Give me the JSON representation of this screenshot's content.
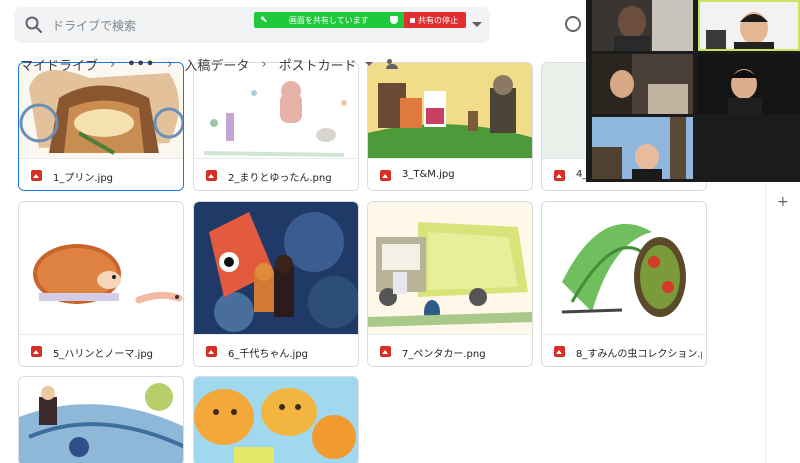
{
  "search": {
    "placeholder": "ドライブで検索"
  },
  "screen_share": {
    "status_label": "画面を共有しています",
    "stop_label": "共有の停止"
  },
  "breadcrumb": {
    "root": "マイドライブ",
    "more": "•••",
    "parent": "入稿データ",
    "current": "ポストカード"
  },
  "files": [
    {
      "name": "1_プリン.jpg",
      "selected": true
    },
    {
      "name": "2_まりとゆったん.png",
      "selected": false
    },
    {
      "name": "3_T&M.jpg",
      "selected": false
    },
    {
      "name": "4_",
      "selected": false
    },
    {
      "name": "5_ハリンとノーマ.jpg",
      "selected": false
    },
    {
      "name": "6_千代ちゃん.jpg",
      "selected": false
    },
    {
      "name": "7_ペンタカー.png",
      "selected": false
    },
    {
      "name": "8_すみんの虫コレクション.p...",
      "selected": false
    },
    {
      "name": "",
      "selected": false
    },
    {
      "name": "",
      "selected": false
    }
  ],
  "rail": {
    "add_label": "+"
  },
  "colors": {
    "accent": "#1a73e8",
    "share_green": "#1ec93c",
    "share_red": "#e02f2f",
    "file_icon": "#d93025",
    "active_speaker": "#c8e35c"
  },
  "icons": {
    "search": "search-icon",
    "file": "image-file-icon",
    "shared": "people-icon",
    "add": "plus-icon"
  }
}
